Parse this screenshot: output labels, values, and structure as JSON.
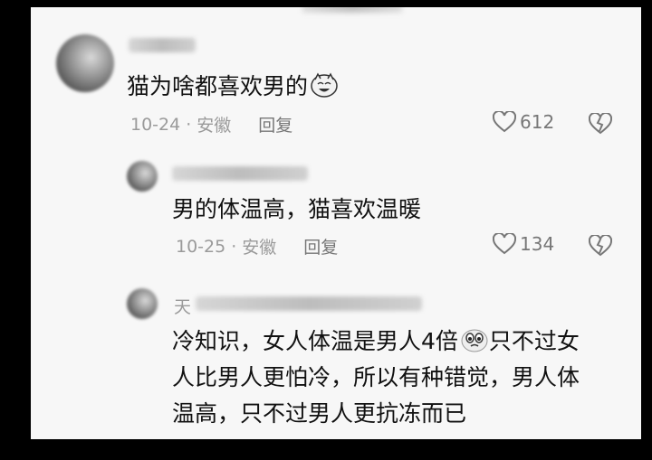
{
  "comments": [
    {
      "text": "猫为啥都喜欢男的",
      "emoji": "laughing-cat-emoji",
      "date": "10-24",
      "separator": "·",
      "location": "安徽",
      "reply_label": "回复",
      "likes": "612"
    },
    {
      "text": "男的体温高，猫喜欢温暖",
      "date": "10-25",
      "separator": "·",
      "location": "安徽",
      "reply_label": "回复",
      "likes": "134"
    },
    {
      "name_partial": "天",
      "lines": [
        "冷知识，女人体温是男人4倍",
        "只不过女",
        "人比男人更怕冷，所以有种错觉，男人体",
        "温高，只不过男人更抗冻而已"
      ],
      "emoji": "teary-eyes-emoji"
    }
  ]
}
